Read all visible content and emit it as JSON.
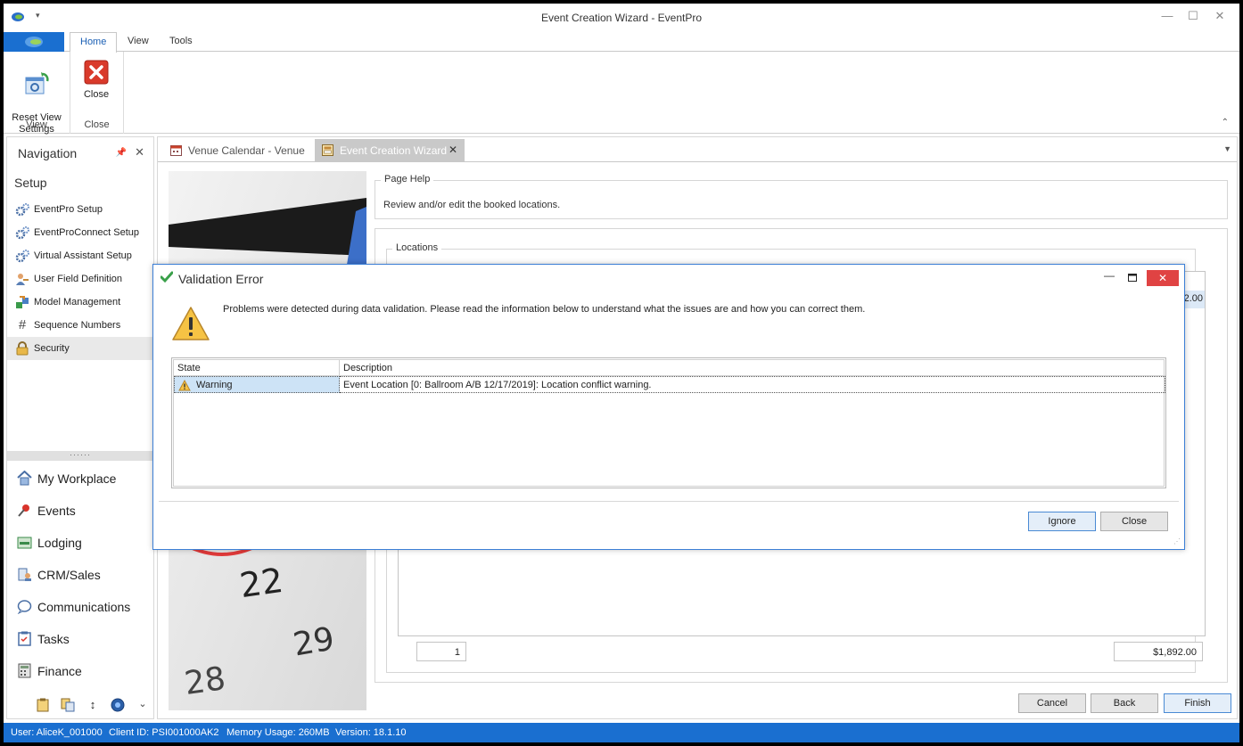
{
  "window": {
    "title": "Event Creation Wizard - EventPro"
  },
  "ribbon": {
    "tabs": [
      "Home",
      "View",
      "Tools"
    ],
    "active_tab": "Home",
    "groups": [
      {
        "label": "View",
        "button": "Reset View\nSettings"
      },
      {
        "label": "Close",
        "button": "Close"
      }
    ]
  },
  "navigation": {
    "title": "Navigation",
    "section": "Setup",
    "items": [
      {
        "label": "EventPro Setup",
        "icon": "gears-icon"
      },
      {
        "label": "EventProConnect Setup",
        "icon": "gears-icon"
      },
      {
        "label": "Virtual Assistant Setup",
        "icon": "gears-icon"
      },
      {
        "label": "User Field Definition",
        "icon": "user-field-icon"
      },
      {
        "label": "Model Management",
        "icon": "model-icon"
      },
      {
        "label": "Sequence Numbers",
        "icon": "hash-icon"
      },
      {
        "label": "Security",
        "icon": "lock-icon"
      }
    ],
    "selected_item": "Security",
    "modules": [
      {
        "label": "My Workplace",
        "icon": "home-icon"
      },
      {
        "label": "Events",
        "icon": "pin-icon"
      },
      {
        "label": "Lodging",
        "icon": "lodging-icon"
      },
      {
        "label": "CRM/Sales",
        "icon": "crm-icon"
      },
      {
        "label": "Communications",
        "icon": "speech-bubble-icon"
      },
      {
        "label": "Tasks",
        "icon": "clipboard-icon"
      },
      {
        "label": "Finance",
        "icon": "calculator-icon"
      }
    ]
  },
  "doc_tabs": [
    {
      "label": "Venue Calendar - Venue",
      "active": false
    },
    {
      "label": "Event Creation Wizard",
      "active": true
    }
  ],
  "wizard": {
    "page_help_caption": "Page Help",
    "page_help_text": "Review and/or edit the booked locations.",
    "locations_caption": "Locations",
    "partial_value": "2.00",
    "footer_count": "1",
    "footer_total": "$1,892.00",
    "buttons": {
      "cancel": "Cancel",
      "back": "Back",
      "finish": "Finish"
    }
  },
  "dialog": {
    "title": "Validation Error",
    "message": "Problems were detected during data validation. Please read the information below to understand what the issues are and how you can correct them.",
    "columns": [
      "State",
      "Description"
    ],
    "rows": [
      {
        "state": "Warning",
        "description": "Event Location [0: Ballroom A/B 12/17/2019]: Location conflict warning."
      }
    ],
    "buttons": {
      "ignore": "Ignore",
      "close": "Close"
    }
  },
  "calendar_numbers": [
    "22",
    "29",
    "28"
  ],
  "status_bar": {
    "user": "User: AliceK_001000",
    "client": "Client ID: PSI001000AK2",
    "memory": "Memory Usage: 260MB",
    "version": "Version: 18.1.10"
  },
  "colors": {
    "accent": "#1a6fd0",
    "dialog_border": "#3c7fd6",
    "close_red": "#e04343"
  }
}
